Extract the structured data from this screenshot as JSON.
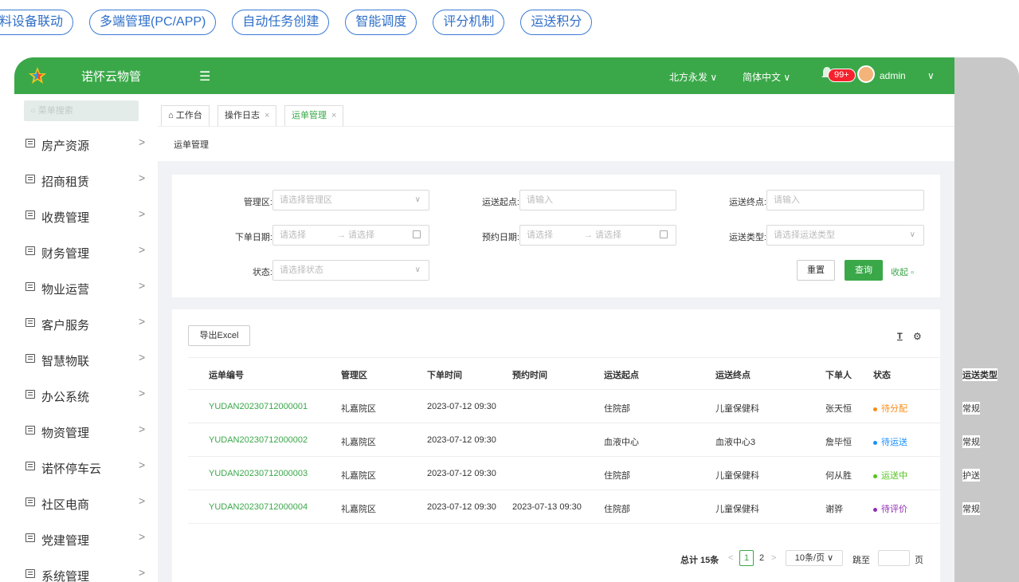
{
  "features": [
    "料设备联动",
    "多端管理(PC/APP)",
    "自动任务创建",
    "智能调度",
    "评分机制",
    "运送积分"
  ],
  "topbar": {
    "brand": "诺怀云物管",
    "menu_toggle": "☰",
    "org": "北方永发 ∨",
    "lang": "简体中文 ∨",
    "badge": "99+",
    "user": "admin",
    "user_caret": "∨"
  },
  "sidebar": {
    "search_placeholder": "菜单搜索",
    "items": [
      {
        "label": "房产资源"
      },
      {
        "label": "招商租赁"
      },
      {
        "label": "收费管理"
      },
      {
        "label": "财务管理"
      },
      {
        "label": "物业运营"
      },
      {
        "label": "客户服务"
      },
      {
        "label": "智慧物联"
      },
      {
        "label": "办公系统"
      },
      {
        "label": "物资管理"
      },
      {
        "label": "诺怀停车云"
      },
      {
        "label": "社区电商"
      },
      {
        "label": "党建管理"
      },
      {
        "label": "系统管理"
      }
    ],
    "chevron": ">"
  },
  "tabs": {
    "home": "⌂ 工作台",
    "log": "操作日志",
    "waybill": "运单管理",
    "close": "×"
  },
  "breadcrumb": "运单管理",
  "filters": {
    "area_label": "管理区:",
    "area_ph": "请选择管理区",
    "start_label": "运送起点:",
    "start_ph": "请输入",
    "end_label": "运送终点:",
    "end_ph": "请输入",
    "order_date_label": "下单日期:",
    "date_ph": "请选择",
    "date_ph2": "→ 请选择",
    "appt_date_label": "预约日期:",
    "type_label": "运送类型:",
    "type_ph": "请选择运送类型",
    "status_label": "状态:",
    "status_ph": "请选择状态",
    "reset": "重置",
    "query": "查询",
    "collapse": "收起",
    "caret": "∨"
  },
  "table": {
    "export": "导出Excel",
    "headers": [
      "运单编号",
      "管理区",
      "下单时间",
      "预约时间",
      "运送起点",
      "运送终点",
      "下单人",
      "状态",
      "运送类型"
    ],
    "rows": [
      {
        "id": "YUDAN20230712000001",
        "area": "礼嘉院区",
        "order_time": "2023-07-12 09:30",
        "appt_time": "",
        "start": "住院部",
        "end": "儿童保健科",
        "user": "张天恒",
        "status": "待分配",
        "type": "常规"
      },
      {
        "id": "YUDAN20230712000002",
        "area": "礼嘉院区",
        "order_time": "2023-07-12 09:30",
        "appt_time": "",
        "start": "血液中心",
        "end": "血液中心3",
        "user": "詹毕恒",
        "status": "待运送",
        "type": "常规"
      },
      {
        "id": "YUDAN20230712000003",
        "area": "礼嘉院区",
        "order_time": "2023-07-12 09:30",
        "appt_time": "",
        "start": "住院部",
        "end": "儿童保健科",
        "user": "何从胜",
        "status": "运送中",
        "type": "护送"
      },
      {
        "id": "YUDAN20230712000004",
        "area": "礼嘉院区",
        "order_time": "2023-07-12 09:30",
        "appt_time": "2023-07-13 09:30",
        "start": "住院部",
        "end": "儿童保健科",
        "user": "谢骅",
        "status": "待评价",
        "type": "常规"
      }
    ],
    "status_colors": [
      "#fa8c16",
      "#1890ff",
      "#52c41a",
      "#8e2eb3"
    ]
  },
  "pagination": {
    "total": "总计 15条",
    "prev": "<",
    "current": "1",
    "page2": "2",
    "next": ">",
    "size": "10条/页 ∨",
    "jump": "跳至",
    "page_unit": "页"
  },
  "colors": {
    "brand_green": "#3aa849",
    "link_blue": "#2f6fc8"
  }
}
